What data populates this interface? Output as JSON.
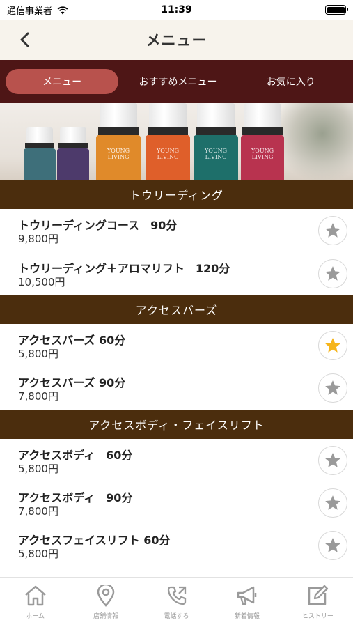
{
  "status_bar": {
    "carrier": "通信事業者",
    "time": "11:39"
  },
  "header": {
    "title": "メニュー"
  },
  "tabs": [
    {
      "label": "メニュー",
      "active": true
    },
    {
      "label": "おすすめメニュー",
      "active": false
    },
    {
      "label": "お気に入り",
      "active": false
    }
  ],
  "banner": {
    "bottle_labels": [
      "YOUNG LIVING",
      "YOUNG LIVING",
      "YOUNG LIVING",
      "YOUNG LIVING"
    ]
  },
  "sections": [
    {
      "title": "トウリーディング",
      "items": [
        {
          "name": "トウリーディングコース　90分",
          "price": "9,800円",
          "favorite": false
        },
        {
          "name": "トウリーディング＋アロマリフト　120分",
          "price": "10,500円",
          "favorite": false
        }
      ]
    },
    {
      "title": "アクセスバーズ",
      "items": [
        {
          "name": "アクセスバーズ 60分",
          "price": "5,800円",
          "favorite": true
        },
        {
          "name": "アクセスバーズ 90分",
          "price": "7,800円",
          "favorite": false
        }
      ]
    },
    {
      "title": "アクセスボディ・フェイスリフト",
      "items": [
        {
          "name": "アクセスボディ　60分",
          "price": "5,800円",
          "favorite": false
        },
        {
          "name": "アクセスボディ　90分",
          "price": "7,800円",
          "favorite": false
        },
        {
          "name": "アクセスフェイスリフト 60分",
          "price": "5,800円",
          "favorite": false
        }
      ]
    }
  ],
  "tabbar": [
    {
      "label": "ホーム",
      "icon": "home-icon"
    },
    {
      "label": "店舗情報",
      "icon": "map-pin-icon"
    },
    {
      "label": "電話する",
      "icon": "phone-icon"
    },
    {
      "label": "新着情報",
      "icon": "megaphone-icon"
    },
    {
      "label": "ヒストリー",
      "icon": "edit-icon"
    }
  ],
  "colors": {
    "tab_bar_bg": "#4e1616",
    "active_tab": "#b8524d",
    "section_header": "#4b2d0d",
    "star_active": "#f6b51b",
    "star_inactive": "#9a9a9a"
  }
}
